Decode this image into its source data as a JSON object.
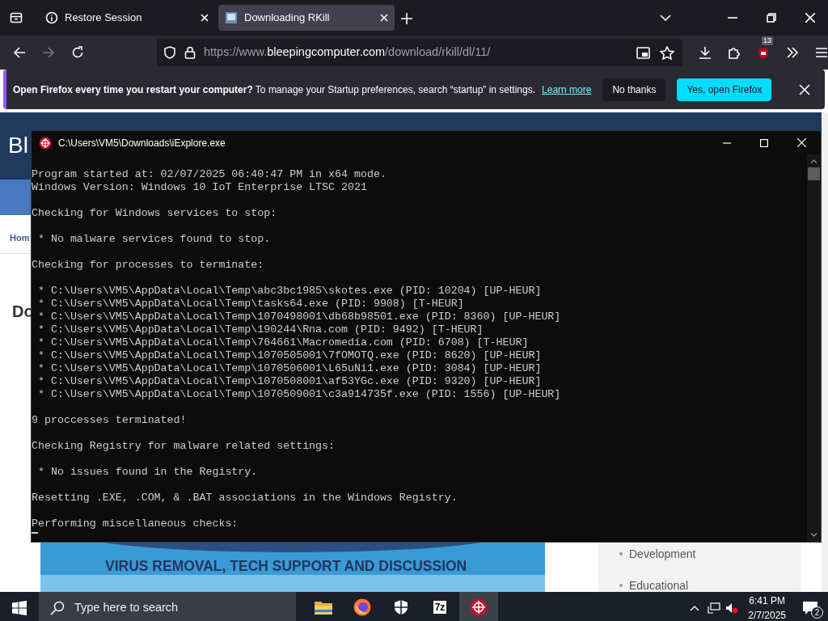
{
  "browser": {
    "tabs": [
      {
        "label": "Restore Session",
        "selected": false,
        "kind": "info"
      },
      {
        "label": "Downloading RKill",
        "selected": true,
        "kind": "page"
      }
    ],
    "url": {
      "prefix": "https://www.",
      "domain": "bleepingcomputer.com",
      "path": "/download/rkill/dl/11/"
    },
    "extension_badge": "13",
    "notification": {
      "message": "**Open Firefox every time you restart your computer?** To manage your Startup preferences, search “startup” in settings.",
      "link": "Learn more",
      "buttons": [
        {
          "label": "No thanks",
          "kind": "secondary"
        },
        {
          "label": "Yes, open Firefox",
          "kind": "primary"
        }
      ]
    }
  },
  "webpage": {
    "logo_fragment": "Bl",
    "breadcrumb_fragment": "Hom",
    "heading_fragment": "Do",
    "banner_text": "VIRUS REMOVAL, TECH SUPPORT AND DISCUSSION",
    "sidebar_items": [
      "Development",
      "Educational"
    ]
  },
  "console": {
    "title": "C:\\Users\\VM5\\Downloads\\iExplore.exe",
    "blocks": [
      {
        "lines": [
          "Program started at: 02/07/2025 06:40:47 PM in x64 mode.",
          "Windows Version: Windows 10 IoT Enterprise LTSC 2021"
        ]
      },
      {
        "lines": [
          "Checking for Windows services to stop:"
        ]
      },
      {
        "lines": [
          " * No malware services found to stop."
        ]
      },
      {
        "lines": [
          "Checking for processes to terminate:"
        ]
      },
      {
        "lines": [
          " * C:\\Users\\VM5\\AppData\\Local\\Temp\\abc3bc1985\\skotes.exe (PID: 10204) [UP-HEUR]",
          " * C:\\Users\\VM5\\AppData\\Local\\Temp\\tasks64.exe (PID: 9908) [T-HEUR]",
          " * C:\\Users\\VM5\\AppData\\Local\\Temp\\1070498001\\db68b98501.exe (PID: 8360) [UP-HEUR]",
          " * C:\\Users\\VM5\\AppData\\Local\\Temp\\190244\\Rna.com (PID: 9492) [T-HEUR]",
          " * C:\\Users\\VM5\\AppData\\Local\\Temp\\764661\\Macromedia.com (PID: 6708) [T-HEUR]",
          " * C:\\Users\\VM5\\AppData\\Local\\Temp\\1070505001\\7fOMOTQ.exe (PID: 8620) [UP-HEUR]",
          " * C:\\Users\\VM5\\AppData\\Local\\Temp\\1070506001\\L65uNi1.exe (PID: 3084) [UP-HEUR]",
          " * C:\\Users\\VM5\\AppData\\Local\\Temp\\1070508001\\af53YGc.exe (PID: 9320) [UP-HEUR]",
          " * C:\\Users\\VM5\\AppData\\Local\\Temp\\1070509001\\c3a914735f.exe (PID: 1556) [UP-HEUR]"
        ]
      },
      {
        "lines": [
          "9 proccesses terminated!"
        ]
      },
      {
        "lines": [
          "Checking Registry for malware related settings:"
        ]
      },
      {
        "lines": [
          " * No issues found in the Registry."
        ]
      },
      {
        "lines": [
          "Resetting .EXE, .COM, & .BAT associations in the Windows Registry."
        ]
      },
      {
        "lines": [
          "Performing miscellaneous checks:"
        ]
      }
    ]
  },
  "taskbar": {
    "search_placeholder": "Type here to search",
    "apps": [
      {
        "kind": "folder",
        "selected": false
      },
      {
        "kind": "firefox",
        "selected": false
      },
      {
        "kind": "shield",
        "selected": false
      },
      {
        "kind": "archiver",
        "label": "7z",
        "selected": false
      },
      {
        "kind": "rkill",
        "selected": true
      }
    ],
    "time": "6:41 PM",
    "date": "2/7/2025",
    "notification_count": "2"
  }
}
